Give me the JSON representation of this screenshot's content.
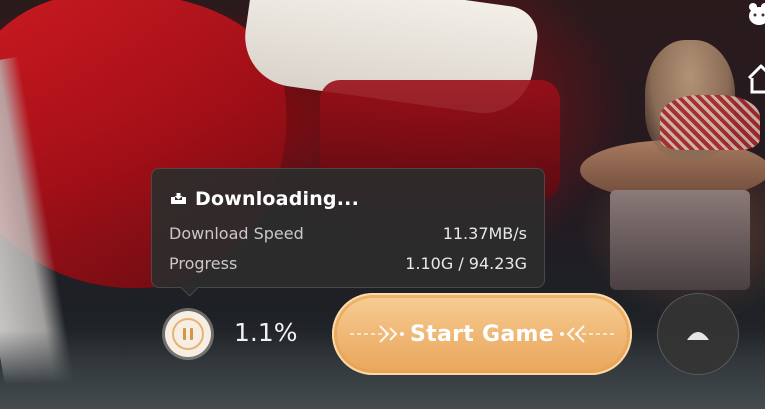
{
  "download_panel": {
    "title": "Downloading...",
    "speed_label": "Download Speed",
    "speed_value": "11.37MB/s",
    "progress_label": "Progress",
    "progress_value": "1.10G / 94.23G",
    "icon": "download-tray-icon"
  },
  "controls": {
    "pause_icon": "pause-icon",
    "percent": "1.1%",
    "start_label": "Start Game",
    "collapse_icon": "chevron-up-icon"
  },
  "side_icons": [
    "bear-icon",
    "home-icon"
  ],
  "colors": {
    "accent": "#efb673",
    "panel_bg": "#2c2c2c",
    "pause_ring": "#e4b377"
  }
}
